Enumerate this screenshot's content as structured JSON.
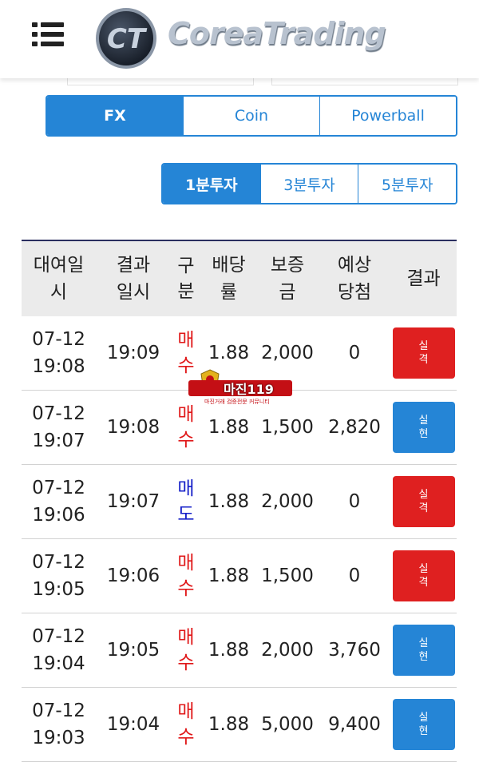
{
  "header": {
    "menu_icon": "hamburger-menu-icon",
    "logo_emblem_text": "CT",
    "logo_text": "CoreaTrading"
  },
  "market_tabs": [
    {
      "label": "FX",
      "active": true
    },
    {
      "label": "Coin",
      "active": false
    },
    {
      "label": "Powerball",
      "active": false
    }
  ],
  "interval_tabs": [
    {
      "label": "1분투자",
      "active": true
    },
    {
      "label": "3분투자",
      "active": false
    },
    {
      "label": "5분투자",
      "active": false
    }
  ],
  "table": {
    "headers": [
      "대여일시",
      "결과일시",
      "구분",
      "배당률",
      "보증금",
      "예상당첨",
      "결과"
    ],
    "rows": [
      {
        "date": "07-12",
        "time": "19:08",
        "result_time": "19:09",
        "type": "매수",
        "rate": "1.88",
        "deposit": "2,000",
        "expected": "0",
        "result": "실격"
      },
      {
        "date": "07-12",
        "time": "19:07",
        "result_time": "19:08",
        "type": "매수",
        "rate": "1.88",
        "deposit": "1,500",
        "expected": "2,820",
        "result": "실현"
      },
      {
        "date": "07-12",
        "time": "19:06",
        "result_time": "19:07",
        "type": "매도",
        "rate": "1.88",
        "deposit": "2,000",
        "expected": "0",
        "result": "실격"
      },
      {
        "date": "07-12",
        "time": "19:05",
        "result_time": "19:06",
        "type": "매수",
        "rate": "1.88",
        "deposit": "1,500",
        "expected": "0",
        "result": "실격"
      },
      {
        "date": "07-12",
        "time": "19:04",
        "result_time": "19:05",
        "type": "매수",
        "rate": "1.88",
        "deposit": "2,000",
        "expected": "3,760",
        "result": "실현"
      },
      {
        "date": "07-12",
        "time": "19:03",
        "result_time": "19:04",
        "type": "매수",
        "rate": "1.88",
        "deposit": "5,000",
        "expected": "9,400",
        "result": "실현"
      }
    ]
  },
  "watermark": {
    "title": "마진119",
    "subtitle": "마진거래 검증전문 커뮤니티"
  },
  "colors": {
    "accent": "#2585d6",
    "buy": "#e0191a",
    "sell": "#1620c8",
    "lose_button": "#df2020",
    "win_button": "#2585d6",
    "table_header_bg": "#ebebeb",
    "table_top_border": "#2a2f60"
  }
}
